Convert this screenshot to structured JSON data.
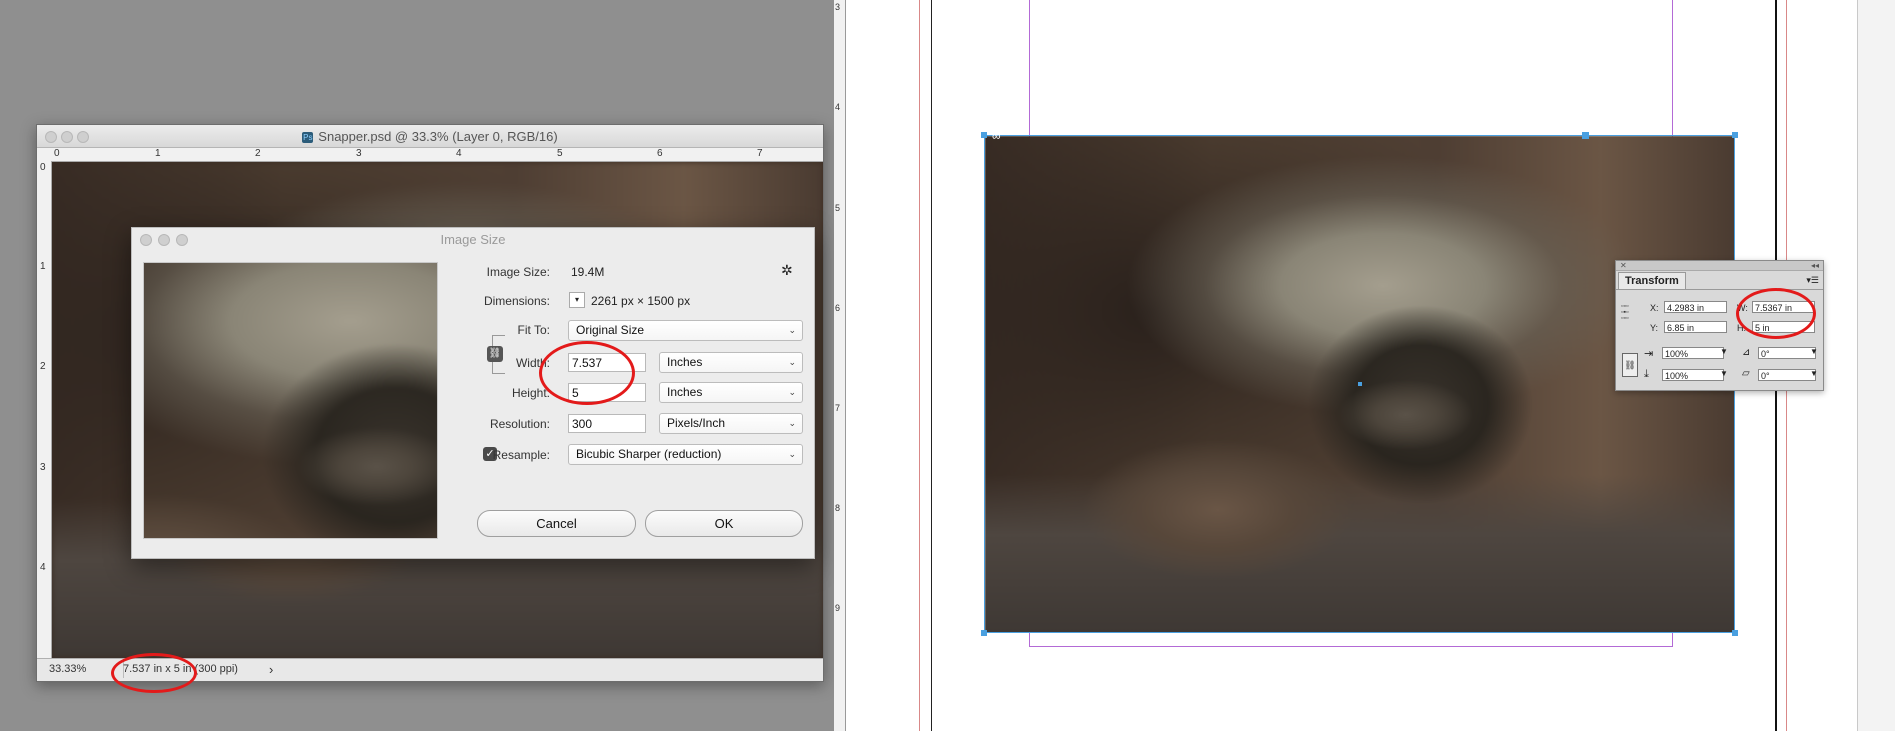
{
  "photoshop": {
    "title": "Snapper.psd @ 33.3% (Layer 0, RGB/16)",
    "app_badge": "Ps",
    "ruler_h": [
      "0",
      "1",
      "2",
      "3",
      "4",
      "5",
      "6",
      "7"
    ],
    "ruler_v": [
      "0",
      "1",
      "2",
      "3",
      "4"
    ],
    "zoom": "33.33%",
    "doc_info": "7.537 in x 5 in (300 ppi)",
    "status_arrow": "›"
  },
  "dialog": {
    "title": "Image Size",
    "image_size_label": "Image Size:",
    "image_size_value": "19.4M",
    "gear": "✲",
    "dimensions_label": "Dimensions:",
    "dimensions_value": "2261 px  ×  1500 px",
    "fit_to_label": "Fit To:",
    "fit_to_value": "Original Size",
    "width_label": "Width:",
    "width_value": "7.537",
    "width_unit": "Inches",
    "height_label": "Height:",
    "height_value": "5",
    "height_unit": "Inches",
    "resolution_label": "Resolution:",
    "resolution_value": "300",
    "resolution_unit": "Pixels/Inch",
    "resample_label": "Resample:",
    "resample_checked": "✓",
    "resample_value": "Bicubic Sharper (reduction)",
    "cancel_label": "Cancel",
    "ok_label": "OK"
  },
  "indesign": {
    "ruler_v": [
      "3",
      "4",
      "5",
      "6",
      "7",
      "8",
      "9"
    ]
  },
  "transform": {
    "tab_label": "Transform",
    "x_label": "X:",
    "x_value": "4.2983 in",
    "y_label": "Y:",
    "y_value": "6.85 in",
    "w_label": "W:",
    "w_value": "7.5367 in",
    "h_label": "H:",
    "h_value": "5 in",
    "scale_x_value": "100%",
    "scale_y_value": "100%",
    "rotate_value": "0°",
    "shear_value": "0°",
    "close": "✕",
    "collapse": "◂◂"
  },
  "colors": {
    "annotation": "#e31a1a",
    "selection": "#4aa0e0",
    "guide": "#b36ad6"
  }
}
